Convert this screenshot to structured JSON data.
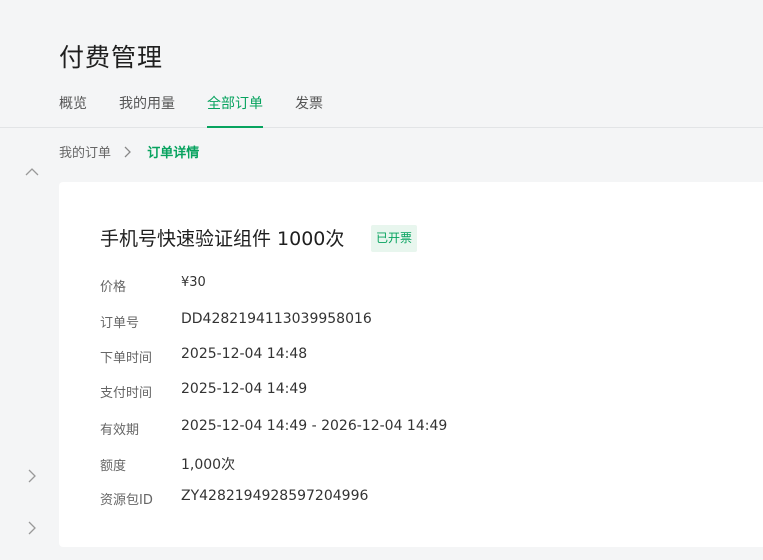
{
  "header": {
    "title": "付费管理"
  },
  "tabs": [
    {
      "label": "概览"
    },
    {
      "label": "我的用量"
    },
    {
      "label": "全部订单",
      "active": true
    },
    {
      "label": "发票"
    }
  ],
  "breadcrumb": {
    "parent": "我的订单",
    "current": "订单详情"
  },
  "order": {
    "title": "手机号快速验证组件 1000次",
    "status": "已开票",
    "fields": [
      {
        "label": "价格",
        "value": "¥30"
      },
      {
        "label": "订单号",
        "value": "DD4282194113039958016"
      },
      {
        "label": "下单时间",
        "value": "2025-12-04 14:48"
      },
      {
        "label": "支付时间",
        "value": "2025-12-04 14:49"
      },
      {
        "label": "有效期",
        "value": "2025-12-04 14:49 - 2026-12-04 14:49"
      },
      {
        "label": "额度",
        "value": "1,000次"
      },
      {
        "label": "资源包ID",
        "value": "ZY4282194928597204996"
      }
    ]
  },
  "colors": {
    "accent": "#07a35f",
    "background": "#f4f5f6",
    "badge_bg": "#e8f6ee"
  },
  "icons": {
    "sidebar": [
      "chevron-up-icon",
      "chevron-right-icon",
      "chevron-right-icon"
    ],
    "breadcrumb_separator": "chevron-right-icon"
  }
}
